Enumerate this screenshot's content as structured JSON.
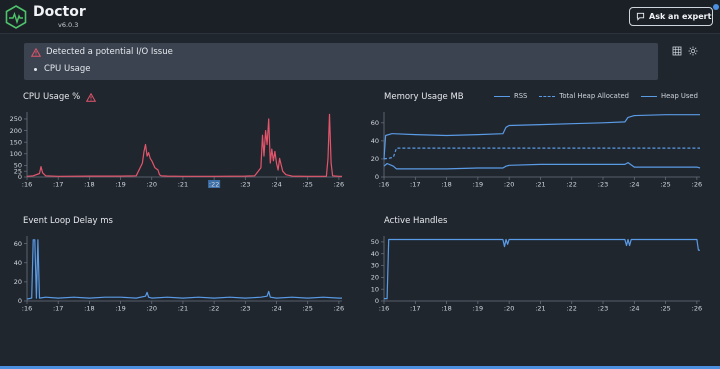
{
  "app": {
    "title": "Doctor",
    "version": "v6.0.3"
  },
  "header": {
    "ask_expert_label": "Ask an expert"
  },
  "alert": {
    "message": "Detected a potential I/O Issue",
    "items": [
      "CPU Usage"
    ]
  },
  "colors": {
    "cpu": "#e3556b",
    "series": "#5a9be6",
    "background": "#20262e",
    "alert_bg": "#3b4350",
    "accent": "#4a8fe0"
  },
  "icons": {
    "logo": "heartbeat-logo-icon",
    "warning": "warning-triangle-icon",
    "chat": "chat-bubble-icon",
    "grid": "grid-icon",
    "theme": "sun-icon"
  },
  "panels": {
    "cpu": {
      "title": "CPU Usage %"
    },
    "memory": {
      "title": "Memory Usage MB",
      "legend": [
        "RSS",
        "Total Heap Allocated",
        "Heap Used"
      ]
    },
    "delay": {
      "title": "Event Loop Delay ms"
    },
    "handles": {
      "title": "Active Handles"
    }
  },
  "chart_data": [
    {
      "type": "line",
      "title": "CPU Usage %",
      "x_ticks": [
        ":16",
        ":17",
        ":18",
        ":19",
        ":20",
        ":21",
        ":22",
        ":23",
        ":24",
        ":25",
        ":26"
      ],
      "highlighted_tick": ":22",
      "y_ticks": [
        0,
        25,
        50,
        100,
        150,
        200,
        250
      ],
      "ylim": [
        0,
        280
      ],
      "series": [
        {
          "x": [
            0,
            0.2,
            0.4,
            0.45,
            0.5,
            0.6,
            1,
            2,
            3,
            3.5,
            3.7,
            3.75,
            3.8,
            3.85,
            3.9,
            3.95,
            4.0,
            4.1,
            4.2,
            4.25,
            4.3,
            4.5,
            5,
            6,
            7,
            7.3,
            7.5,
            7.55,
            7.6,
            7.65,
            7.7,
            7.75,
            7.8,
            7.85,
            7.9,
            7.95,
            8.0,
            8.05,
            8.1,
            8.2,
            8.3,
            8.5,
            9,
            9.6,
            9.65,
            9.7,
            9.75,
            9.8,
            10,
            10.1
          ],
          "y": [
            3,
            5,
            15,
            45,
            18,
            5,
            3,
            4,
            4,
            5,
            60,
            110,
            140,
            90,
            105,
            80,
            70,
            40,
            30,
            10,
            5,
            4,
            3,
            3,
            4,
            5,
            40,
            180,
            90,
            200,
            140,
            250,
            60,
            120,
            70,
            110,
            60,
            30,
            80,
            25,
            10,
            4,
            3,
            3,
            80,
            270,
            60,
            5,
            3,
            3
          ]
        }
      ]
    },
    {
      "type": "line",
      "title": "Memory Usage MB",
      "x_ticks": [
        ":16",
        ":17",
        ":18",
        ":19",
        ":20",
        ":21",
        ":22",
        ":23",
        ":24",
        ":25",
        ":26"
      ],
      "y_ticks": [
        0,
        20,
        40,
        60
      ],
      "ylim": [
        0,
        72
      ],
      "series": [
        {
          "name": "RSS",
          "x": [
            0,
            0.05,
            0.25,
            0.3,
            1,
            2,
            3,
            3.8,
            3.9,
            4,
            5,
            6,
            7,
            7.7,
            7.8,
            8,
            9,
            10,
            10.1
          ],
          "y": [
            20,
            46,
            48,
            48,
            47,
            46,
            47,
            48,
            55,
            57,
            58,
            59,
            60,
            61,
            66,
            68,
            69,
            69,
            69
          ]
        },
        {
          "name": "Total Heap Allocated",
          "x": [
            0,
            0.2,
            0.3,
            0.4,
            1,
            2,
            3,
            4,
            5,
            6,
            7,
            8,
            9,
            10,
            10.1
          ],
          "y": [
            20,
            21,
            22,
            32,
            32,
            32,
            32,
            32,
            32,
            32,
            32,
            32,
            32,
            32,
            32
          ]
        },
        {
          "name": "Heap Used",
          "x": [
            0,
            0.1,
            0.3,
            0.4,
            1,
            2,
            3,
            3.8,
            3.9,
            4,
            5,
            6,
            7,
            7.7,
            7.8,
            8,
            9,
            10,
            10.1
          ],
          "y": [
            12,
            15,
            12,
            9,
            9,
            9,
            10,
            10,
            12,
            13,
            14,
            14,
            14,
            14,
            16,
            11,
            11,
            11,
            10
          ]
        }
      ]
    },
    {
      "type": "line",
      "title": "Event Loop Delay ms",
      "x_ticks": [
        ":16",
        ":17",
        ":18",
        ":19",
        ":20",
        ":21",
        ":22",
        ":23",
        ":24",
        ":25",
        ":26"
      ],
      "y_ticks": [
        0,
        20,
        40,
        60
      ],
      "ylim": [
        0,
        68
      ],
      "series": [
        {
          "x": [
            0,
            0.15,
            0.2,
            0.25,
            0.3,
            0.35,
            0.4,
            0.6,
            1,
            1.5,
            2,
            2.5,
            3,
            3.5,
            3.8,
            3.85,
            3.9,
            4,
            4.5,
            5,
            5.5,
            6,
            6.5,
            7,
            7.5,
            7.7,
            7.75,
            7.8,
            8,
            8.5,
            9,
            9.5,
            10,
            10.1
          ],
          "y": [
            2,
            3,
            64,
            64,
            3,
            64,
            3,
            4,
            3,
            4,
            3,
            4,
            4,
            3,
            5,
            9,
            4,
            3,
            4,
            3,
            4,
            3,
            4,
            3,
            4,
            5,
            10,
            4,
            3,
            4,
            3,
            4,
            3,
            3
          ]
        }
      ]
    },
    {
      "type": "line",
      "title": "Active Handles",
      "x_ticks": [
        ":16",
        ":17",
        ":18",
        ":19",
        ":20",
        ":21",
        ":22",
        ":23",
        ":24",
        ":25",
        ":26"
      ],
      "y_ticks": [
        0,
        10,
        20,
        30,
        40,
        50
      ],
      "ylim": [
        0,
        55
      ],
      "series": [
        {
          "x": [
            0,
            0.1,
            0.15,
            0.2,
            1,
            2,
            3,
            3.8,
            3.85,
            3.9,
            3.95,
            4.0,
            5,
            6,
            7,
            7.7,
            7.75,
            7.8,
            7.85,
            7.9,
            9,
            10,
            10.05,
            10.1
          ],
          "y": [
            2,
            2,
            52,
            52,
            52,
            52,
            52,
            52,
            46,
            52,
            48,
            52,
            52,
            52,
            52,
            52,
            47,
            52,
            47,
            52,
            52,
            52,
            43,
            43
          ]
        }
      ]
    }
  ]
}
